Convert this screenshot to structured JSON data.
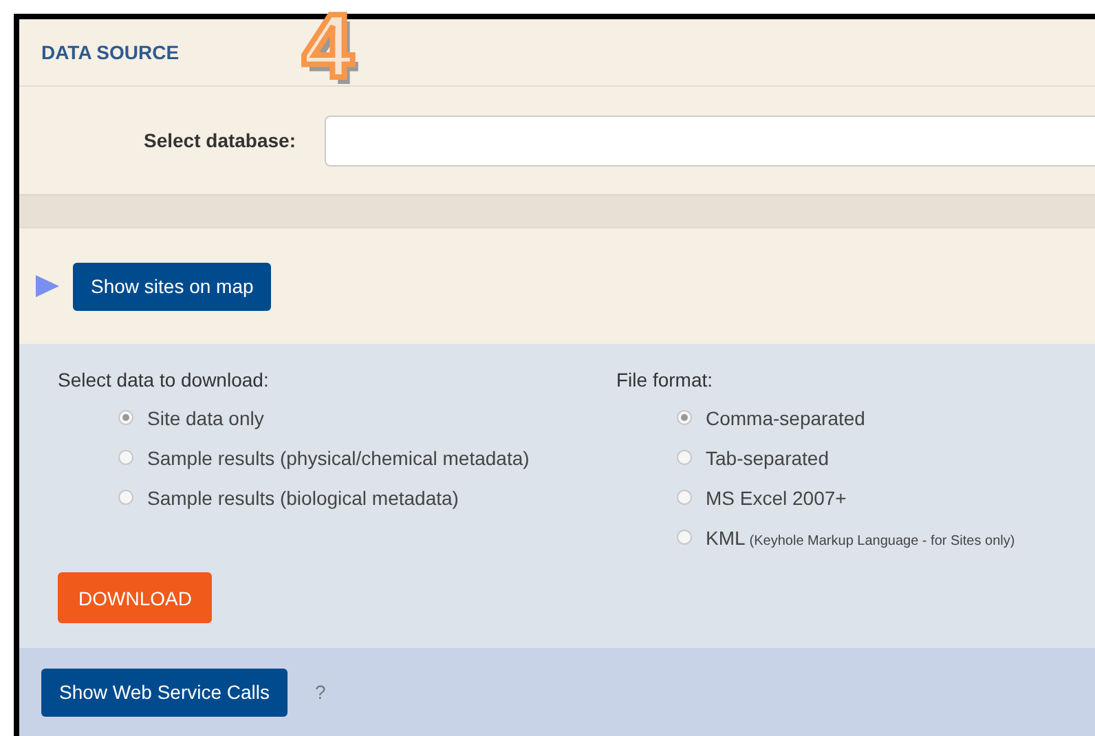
{
  "step_marker": "4",
  "data_source": {
    "title": "DATA SOURCE",
    "database_label": "Select database:"
  },
  "map": {
    "button": "Show sites on map"
  },
  "download": {
    "data_title": "Select data to download:",
    "data_options": [
      {
        "label": "Site data only",
        "selected": true
      },
      {
        "label": "Sample results (physical/chemical metadata)",
        "selected": false
      },
      {
        "label": "Sample results (biological metadata)",
        "selected": false
      }
    ],
    "format_title": "File format:",
    "format_options": [
      {
        "label": "Comma-separated",
        "selected": true
      },
      {
        "label": "Tab-separated",
        "selected": false
      },
      {
        "label": "MS Excel 2007+",
        "selected": false
      },
      {
        "label": "KML",
        "note": "(Keyhole Markup Language - for Sites only)",
        "selected": false
      }
    ],
    "button": "DOWNLOAD"
  },
  "web_service": {
    "button": "Show Web Service Calls",
    "help": "?"
  }
}
